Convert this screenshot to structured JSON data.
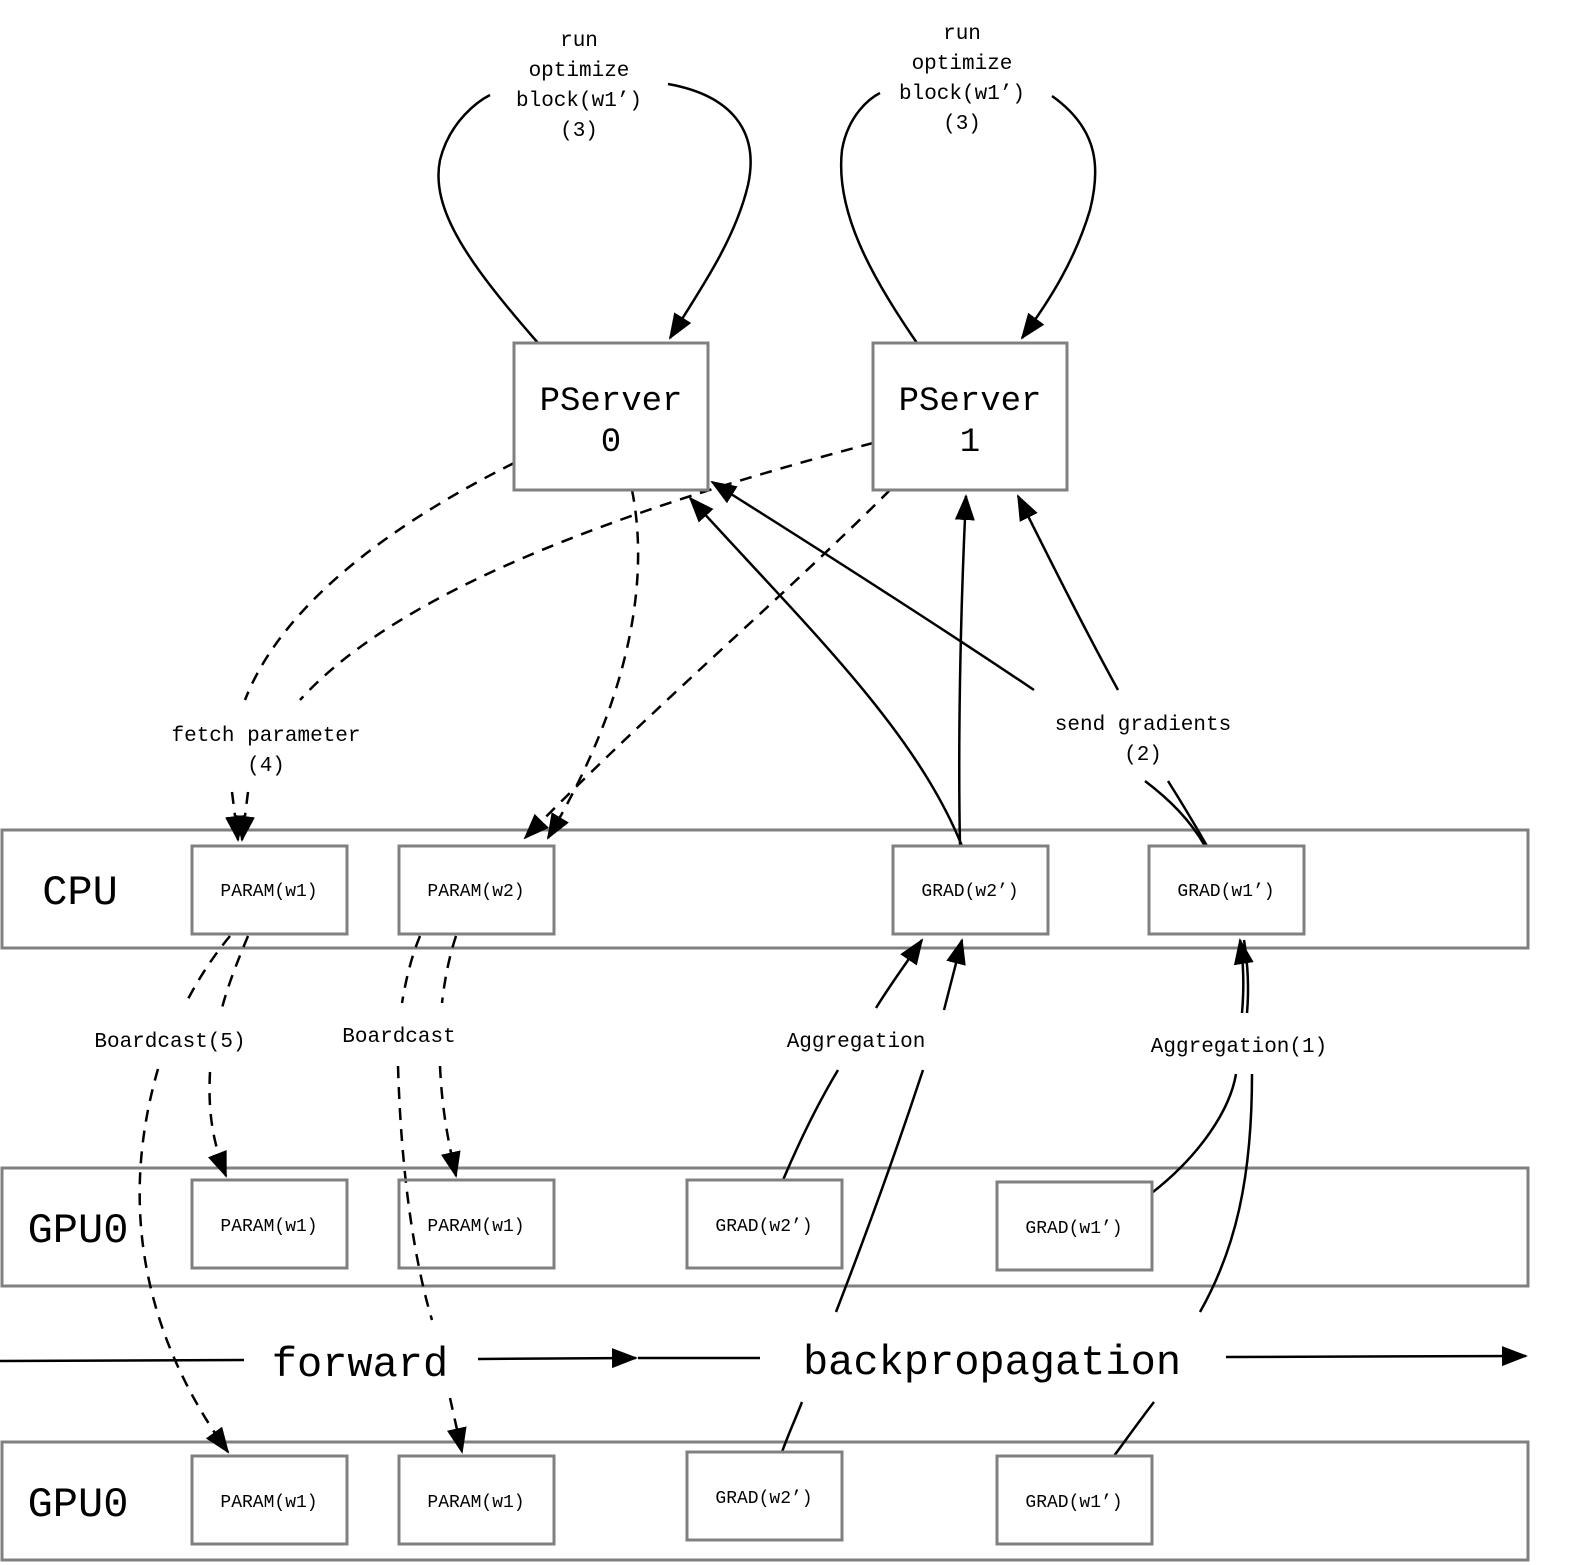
{
  "loops": [
    {
      "lines": [
        "run",
        "optimize",
        "block(w1’)",
        "(3)"
      ]
    },
    {
      "lines": [
        "run",
        "optimize",
        "block(w1’)",
        "(3)"
      ]
    }
  ],
  "pservers": [
    {
      "line1": "PServer",
      "line2": "0"
    },
    {
      "line1": "PServer",
      "line2": "1"
    }
  ],
  "labels": {
    "fetch": [
      "fetch parameter",
      "(4)"
    ],
    "send": [
      "send gradients",
      "(2)"
    ],
    "broadcast1": "Boardcast(5)",
    "broadcast2": "Boardcast",
    "aggregation1": "Aggregation",
    "aggregation2": "Aggregation(1)",
    "forward": "forward",
    "backprop": "backpropagation"
  },
  "lanes": [
    {
      "name": "CPU",
      "boxes": [
        "PARAM(w1)",
        "PARAM(w2)",
        "GRAD(w2’)",
        "GRAD(w1’)"
      ]
    },
    {
      "name": "GPU0",
      "boxes": [
        "PARAM(w1)",
        "PARAM(w1)",
        "GRAD(w2’)",
        "GRAD(w1’)"
      ]
    },
    {
      "name": "GPU0",
      "boxes": [
        "PARAM(w1)",
        "PARAM(w1)",
        "GRAD(w2’)",
        "GRAD(w1’)"
      ]
    }
  ]
}
